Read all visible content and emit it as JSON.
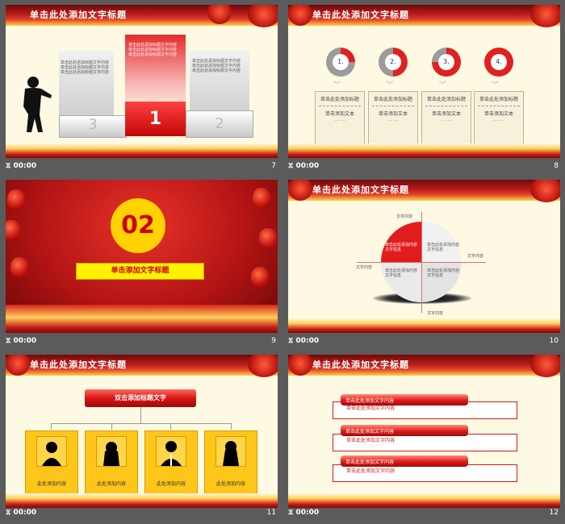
{
  "colors": {
    "red": "#d21b1b",
    "gold": "#ffc61a",
    "cream": "#fdf9e2",
    "gray": "#5b5b5b"
  },
  "footer_time": "00:00",
  "slides": [
    {
      "num": "7",
      "title": "单击此处添加文字标题",
      "podium": {
        "first": "1",
        "second": "2",
        "third": "3",
        "text": "单击此处添加标题文字内容\n单击此处添加标题文字内容\n单击此处添加标题文字内容"
      }
    },
    {
      "num": "8",
      "title": "单击此处添加文字标题",
      "items": [
        {
          "n": "1.",
          "head": "单击此处添加标题",
          "body": "单击添加文本",
          "dots": "… …"
        },
        {
          "n": "2.",
          "head": "单击此处添加标题",
          "body": "单击添加文本",
          "dots": "… …"
        },
        {
          "n": "3.",
          "head": "单击此处添加标题",
          "body": "单击添加文本",
          "dots": "… …"
        },
        {
          "n": "4.",
          "head": "单击此处添加标题",
          "body": "单击添加文本",
          "dots": "… …"
        }
      ]
    },
    {
      "num": "9",
      "big": "02",
      "subtitle": "单击添加文字标题"
    },
    {
      "num": "10",
      "title": "单击此处添加文字标题",
      "quad": {
        "tl": "单击此处添加内容文字信息",
        "tr": "单击此处添加内容文字信息",
        "bl": "单击此处添加内容文字信息",
        "br": "单击此处添加内容文字信息"
      },
      "labels": {
        "top": "文字内容",
        "right": "文字内容",
        "left": "文字内容",
        "bottom": "文字内容"
      }
    },
    {
      "num": "11",
      "title": "单击此处添加文字标题",
      "head": "双击添加标题文字",
      "people": [
        "此处添加内容",
        "此处添加内容",
        "此处添加内容",
        "此处添加内容"
      ]
    },
    {
      "num": "12",
      "title": "单击此处添加文字标题",
      "rows": [
        {
          "bar": "单击此处添加文字内容",
          "box": "单击此处添加文字内容"
        },
        {
          "bar": "单击此处添加文字内容",
          "box": "单击此处添加文字内容"
        },
        {
          "bar": "单击此处添加文字内容",
          "box": "单击此处添加文字内容"
        }
      ]
    }
  ]
}
